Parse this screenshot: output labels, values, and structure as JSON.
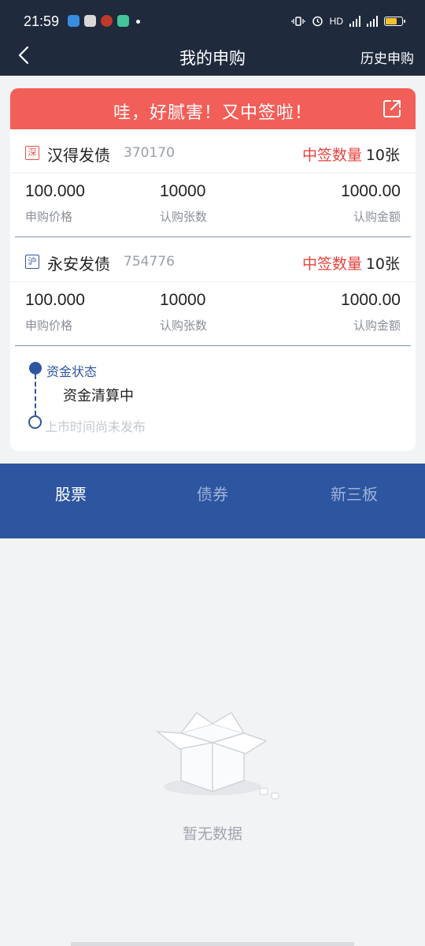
{
  "status_bar": {
    "time": "21:59",
    "network_label": "HD",
    "battery_level": 0.7
  },
  "header": {
    "title": "我的申购",
    "history_label": "历史申购"
  },
  "result_card": {
    "banner_text": "哇，好腻害！又中签啦！",
    "bonds": [
      {
        "market": "深",
        "name": "汉得发债",
        "code": "370170",
        "winning_label": "中签数量",
        "winning_value": "10张",
        "price": "100.000",
        "price_label": "申购价格",
        "quantity": "10000",
        "quantity_label": "认购张数",
        "amount": "1000.00",
        "amount_label": "认购金额"
      },
      {
        "market": "沪",
        "name": "永安发债",
        "code": "754776",
        "winning_label": "中签数量",
        "winning_value": "10张",
        "price": "100.000",
        "price_label": "申购价格",
        "quantity": "10000",
        "quantity_label": "认购张数",
        "amount": "1000.00",
        "amount_label": "认购金额"
      }
    ],
    "timeline": {
      "step1_title": "资金状态",
      "step1_detail": "资金清算中",
      "step2_title": "上市时间尚未发布"
    }
  },
  "tabs": [
    {
      "label": "股票",
      "active": true
    },
    {
      "label": "债券",
      "active": false
    },
    {
      "label": "新三板",
      "active": false
    }
  ],
  "empty_state": {
    "text": "暂无数据",
    "icon": "empty-box-icon"
  },
  "colors": {
    "header_bg": "#1f2a3d",
    "banner": "#f25e58",
    "accent_blue": "#2d55a0",
    "win_red": "#e8423c"
  }
}
